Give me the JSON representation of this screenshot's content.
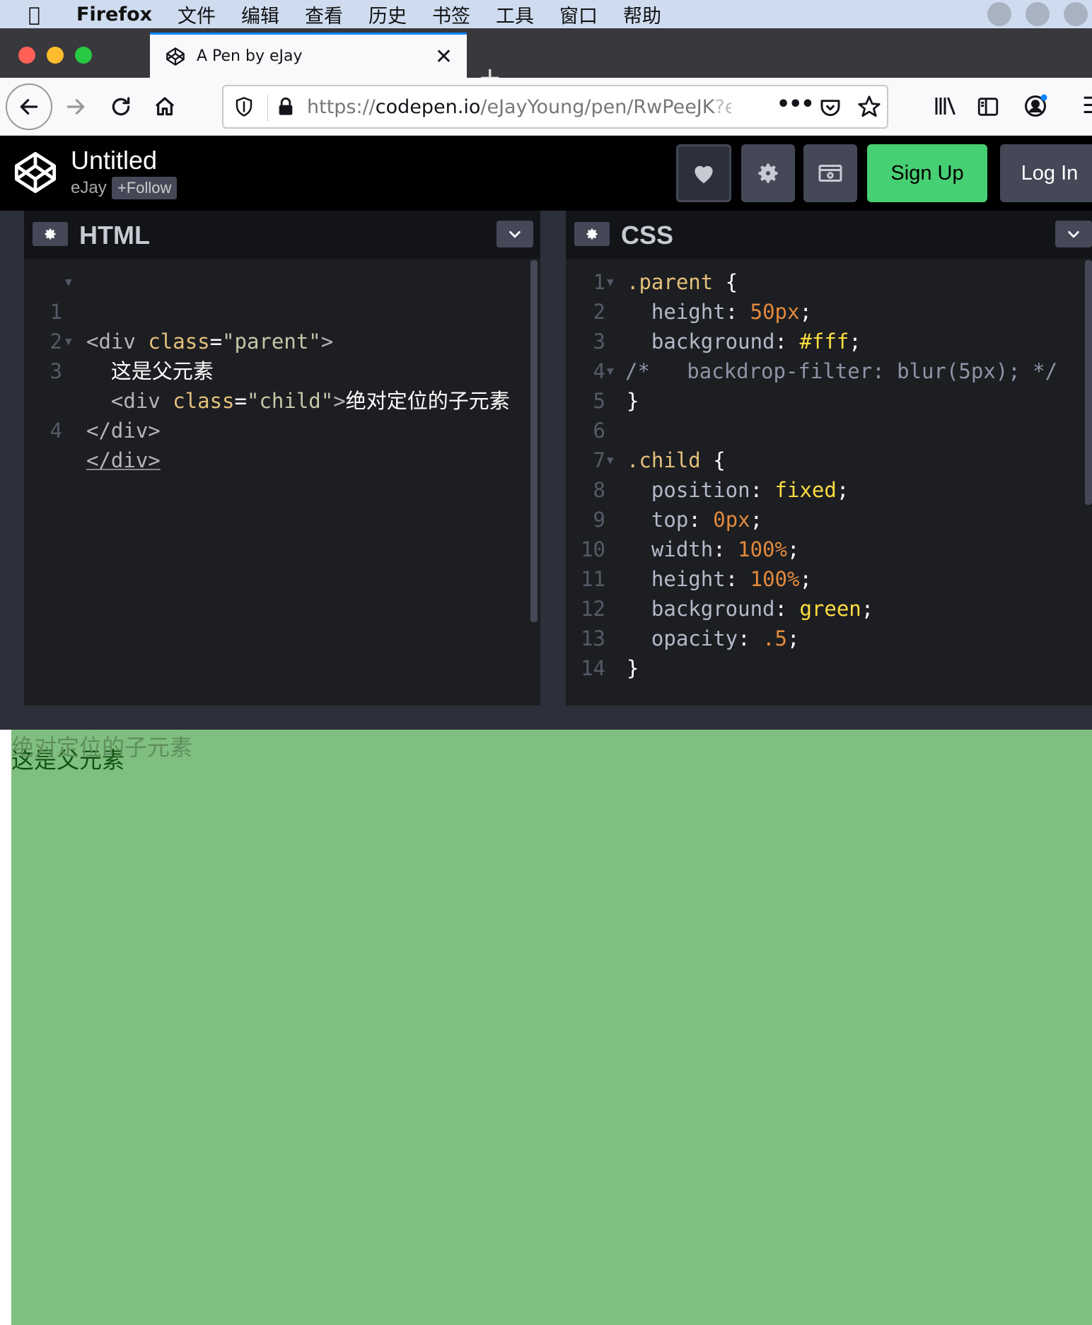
{
  "menubar": {
    "app": "Firefox",
    "items": [
      "文件",
      "编辑",
      "查看",
      "历史",
      "书签",
      "工具",
      "窗口",
      "帮助"
    ]
  },
  "tab": {
    "title": "A Pen by eJay"
  },
  "url": {
    "scheme": "https://",
    "host": "codepen.io",
    "path": "/eJayYoung/pen/RwPeeJK",
    "tail": "?e"
  },
  "pen": {
    "title": "Untitled",
    "author": "eJay",
    "follow_label": "+Follow"
  },
  "header_buttons": {
    "signup": "Sign Up",
    "login": "Log In"
  },
  "html_panel": {
    "label": "HTML",
    "lines": [
      {
        "n": "1",
        "a": "<div ",
        "b": "class",
        "c": "=",
        "d": "\"parent\"",
        "e": ">"
      },
      {
        "n": "2",
        "text": "  这是父元素"
      },
      {
        "n": "3",
        "a": "  <div ",
        "b": "class",
        "c": "=",
        "d": "\"child\"",
        "e": ">",
        "f": "绝对定位的子元素"
      },
      {
        "n": "",
        "close": "</div>"
      },
      {
        "n": "4",
        "close": "</div>"
      }
    ]
  },
  "css_panel": {
    "label": "CSS",
    "lines": [
      {
        "n": "1",
        "sel": ".parent",
        "rest": " {"
      },
      {
        "n": "2",
        "prop": "  height",
        "colon": ": ",
        "val": "50px",
        "end": ";"
      },
      {
        "n": "3",
        "prop": "  background",
        "colon": ": ",
        "val": "#fff",
        "end": ";"
      },
      {
        "n": "4",
        "comment": "/*   backdrop-filter: blur(5px); */"
      },
      {
        "n": "5",
        "rest": "}"
      },
      {
        "n": "6",
        "rest": ""
      },
      {
        "n": "7",
        "sel": ".child",
        "rest": " {"
      },
      {
        "n": "8",
        "prop": "  position",
        "colon": ": ",
        "val": "fixed",
        "end": ";"
      },
      {
        "n": "9",
        "prop": "  top",
        "colon": ": ",
        "val": "0px",
        "end": ";"
      },
      {
        "n": "10",
        "prop": "  width",
        "colon": ": ",
        "val": "100%",
        "end": ";"
      },
      {
        "n": "11",
        "prop": "  height",
        "colon": ": ",
        "val": "100%",
        "end": ";"
      },
      {
        "n": "12",
        "prop": "  background",
        "colon": ": ",
        "val": "green",
        "end": ";"
      },
      {
        "n": "13",
        "prop": "  opacity",
        "colon": ": ",
        "val": ".5",
        "end": ";"
      },
      {
        "n": "14",
        "rest": "}"
      }
    ]
  },
  "preview": {
    "child_text": "绝对定位的子元素",
    "parent_text": "这是父元素"
  },
  "colors": {
    "signup": "#47cf73",
    "preview_overlay": "rgba(0,128,0,0.5)",
    "tab_accent": "#0a84ff"
  }
}
